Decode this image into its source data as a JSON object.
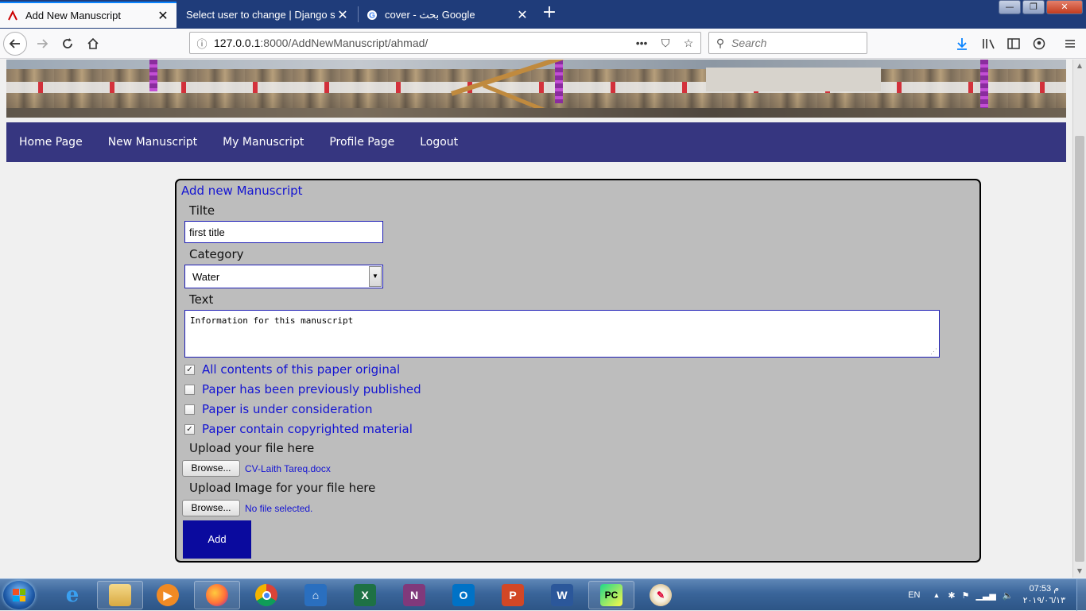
{
  "browser": {
    "tabs": [
      {
        "title": "Add New Manuscript",
        "active": true
      },
      {
        "title": "Select user to change | Django site a",
        "active": false
      },
      {
        "title": "cover - بحث Google",
        "active": false
      }
    ],
    "new_tab": "+",
    "url_host": "127.0.0.1",
    "url_rest": ":8000/AddNewManuscript/ahmad/",
    "url_actions": "•••",
    "search_placeholder": "Search",
    "window_buttons": {
      "minimize": "—",
      "maximize": "❐",
      "close": "✕"
    }
  },
  "menu": {
    "items": [
      "Home Page",
      "New Manuscript",
      "My Manuscript",
      "Profile Page",
      "Logout"
    ]
  },
  "form": {
    "heading": "Add new Manuscript",
    "title_label": "Tilte",
    "title_value": "first title",
    "category_label": "Category",
    "category_value": "Water",
    "text_label": "Text",
    "text_value": "Information for this manuscript",
    "checkboxes": [
      {
        "label": "All contents of this paper original",
        "checked": true
      },
      {
        "label": "Paper has been previously published",
        "checked": false
      },
      {
        "label": "Paper is under consideration",
        "checked": false
      },
      {
        "label": "Paper contain copyrighted material",
        "checked": true
      }
    ],
    "upload_file_label": "Upload your file here",
    "browse_label": "Browse...",
    "uploaded_file": "CV-Laith Tareq.docx",
    "upload_image_label": "Upload Image for your file here",
    "no_file": "No file selected.",
    "add_label": "Add"
  },
  "taskbar": {
    "language": "EN",
    "time": "07:53 م",
    "date": "٢٠١٩/٠٦/١٣",
    "apps": [
      "internet-explorer",
      "file-explorer",
      "media-player",
      "firefox",
      "chrome",
      "store",
      "excel",
      "onenote",
      "outlook",
      "powerpoint",
      "word",
      "pycharm",
      "paint"
    ]
  },
  "colors": {
    "tabbar": "#1f3c7a",
    "menu": "#363680",
    "form_bg": "#bdbdbd",
    "accent_text": "#1414d2",
    "add_button": "#0a0a9e"
  }
}
